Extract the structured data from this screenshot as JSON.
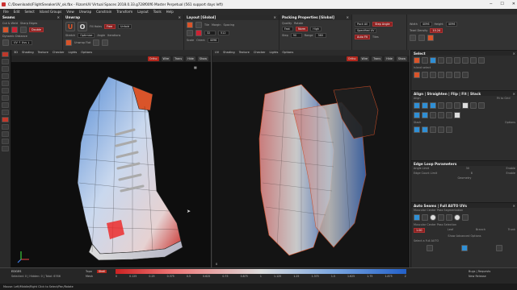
{
  "window": {
    "title": "C:/Downloads/FlightSneakerUV_ok.fbx - RizomUV Virtual Spaces 2018.0.33.g728f00f6 Master Perpetual  (561 support days left)"
  },
  "menu": [
    "File",
    "Edit",
    "Select",
    "Island Groups",
    "View",
    "Unwrap",
    "Constrain",
    "Transform",
    "Layout",
    "Tools",
    "Help"
  ],
  "toolbar": {
    "seams": {
      "title": "Seams",
      "cut_label": "Cut & Weld",
      "pelt_label": "Pelt",
      "sharp_label": "Sharp Edges",
      "mode": "Double",
      "min_label": "Dynamic Distance",
      "uv_label": "UV ↑ Uvs ↓"
    },
    "unwrap": {
      "title": "Unwrap",
      "fill_label": "Fill Holes",
      "mode1": "Free",
      "mode2": "Unfold",
      "mode3": "Optimize",
      "stretch": "Stretch",
      "angle": "Angle",
      "iter": "Iterations",
      "hint": "Unwrap Flat"
    },
    "layout": {
      "title": "Layout [Global]",
      "tile": "Tile",
      "margin": "Margin",
      "spacing": "Spacing",
      "scale": "Scale",
      "orient": "Orient",
      "value_a": "32",
      "value_b": "512",
      "value_c": "4096"
    },
    "packing": {
      "title": "Packing Properties [Global]",
      "quality": "Quality",
      "fast": "Fast",
      "mode": "Norm",
      "high": "High",
      "gold": "Gold",
      "rotate": "Rotate",
      "step": "Step",
      "range": "Range",
      "angle_a": "90",
      "angle_b": "360",
      "pack_all": "Pack All",
      "auto_fit": "Auto Fit"
    },
    "unfold": {
      "title": "Unfold",
      "mode": "Step Angle",
      "spec": "Specified UV",
      "tiles": "Tiles"
    },
    "tiles": {
      "title": "Tiles",
      "width": "Width",
      "height": "Height",
      "w_val": "4096",
      "h_val": "4096",
      "texel": "Texel Density",
      "texel_val": "10.24"
    }
  },
  "viewport3d": {
    "tabs": [
      "3D",
      "Shading",
      "Texture",
      "Checker",
      "Lights",
      "Options"
    ],
    "buttons": [
      "Ortho",
      "Wire",
      "Trans",
      "Hide",
      "Show"
    ],
    "axes": "X Y Z"
  },
  "viewportuv": {
    "tabs": [
      "UV",
      "Shading",
      "Texture",
      "Checker",
      "Lights",
      "Options"
    ],
    "buttons": [
      "Ortho",
      "Wire",
      "Trans",
      "Hide",
      "Show"
    ],
    "tile_label": "0"
  },
  "right": {
    "select": {
      "title": "Select",
      "sub": "Island select",
      "labels": [
        "Islands",
        "Polys",
        "Edges",
        "Verts"
      ]
    },
    "align": {
      "title": "Align | Straighten | Flip | Fit | Stack",
      "fit_label": "Fit to Grid",
      "stack_label": "Stack",
      "align_label": "Align",
      "options": "Options"
    },
    "edgeloop": {
      "title": "Edge Loop Parameters",
      "angle_label": "Angle Limit",
      "count_label": "Edge Count Limit",
      "val1": "30",
      "val2": "8",
      "enable": "Enable",
      "geo": "Geometry"
    },
    "seams": {
      "title": "Auto Seams | Full AUTO UVs",
      "hint1": "Muscular Center Pass Segmentation",
      "hint2": "Muscular Center Pass Selection",
      "val": "1.00",
      "leaf": "Leaf",
      "branch": "Branch",
      "trunk": "Trunk",
      "advanced": "Show Advanced Options",
      "footer": "Select a Full AUTO",
      "pack": "Pack"
    }
  },
  "status": {
    "edges_label": "EDGES",
    "sel": "Selected: 0 | Hidden: 0 | Total: 6766",
    "topo": "Topo",
    "shell": "Shell",
    "mesh": "Mesh",
    "ticks": [
      "0",
      "0.125",
      "0.25",
      "0.375",
      "0.5",
      "0.625",
      "0.75",
      "0.875",
      "1",
      "1.125",
      "1.25",
      "1.375",
      "1.5",
      "1.625",
      "1.75",
      "1.875",
      "2"
    ],
    "bugs": "Bugs | Requests",
    "next": "New Release",
    "bottom": "Mouse: Left/Middle/Right Click to Select/Pan/Rotate"
  },
  "colors": {
    "accent": "#d9542a",
    "red": "#b3271d",
    "blue": "#2360c9"
  }
}
